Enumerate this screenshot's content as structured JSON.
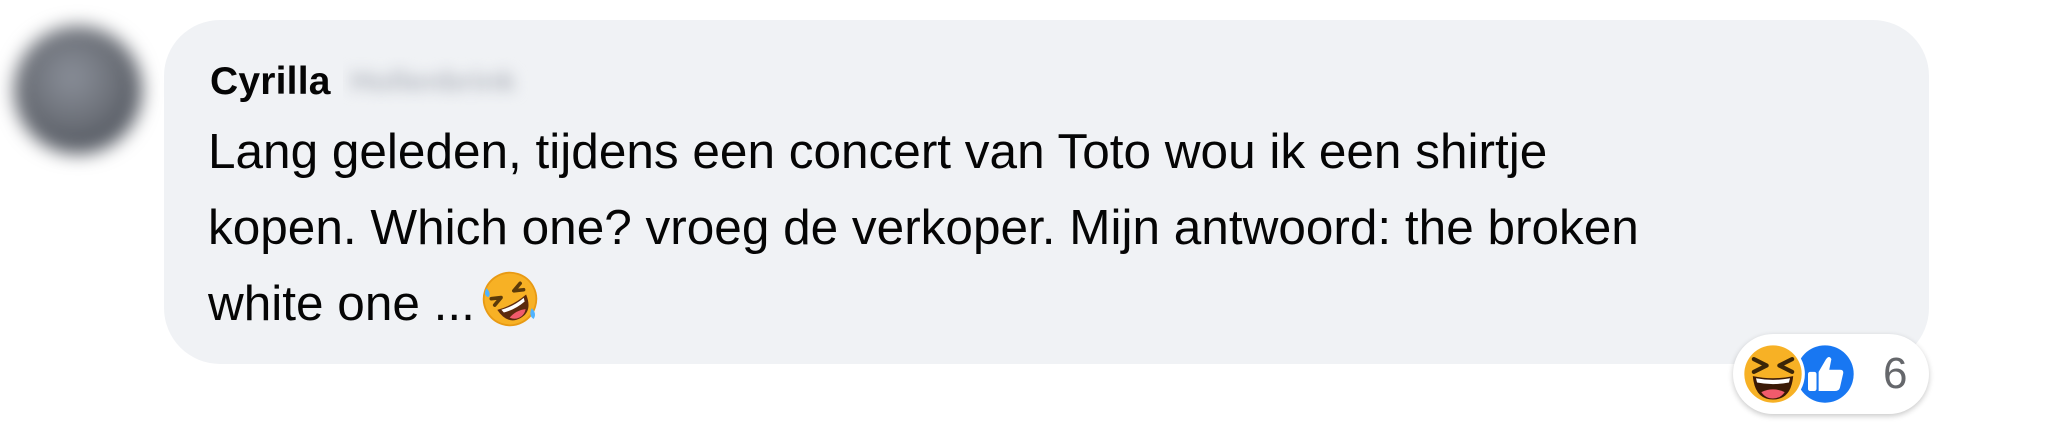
{
  "comment": {
    "author_first": "Cyrilla",
    "author_last_blurred": "Hollenbrink",
    "text": "Lang geleden, tijdens een concert van Toto wou ik een shirtje\nkopen. Which one? vroeg de verkoper. Mijn antwoord: the broken\nwhite one ...",
    "inline_emoji": "rolling-on-floor-laughing-emoji"
  },
  "reactions": {
    "icons": [
      "haha-reaction-icon",
      "like-reaction-icon"
    ],
    "count": "6",
    "colors": {
      "like": "#1877f2",
      "haha": "#f7b125"
    }
  },
  "colors": {
    "bubble": "#f0f2f5",
    "text": "#050505",
    "muted": "#65676b"
  }
}
